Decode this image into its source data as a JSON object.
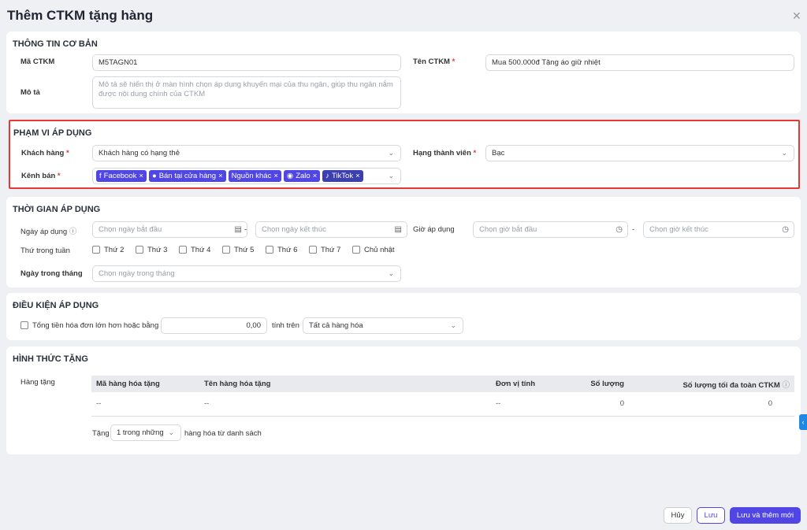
{
  "title": "Thêm CTKM tặng hàng",
  "basic": {
    "heading": "THÔNG TIN CƠ BẢN",
    "code_label": "Mã CTKM",
    "code_value": "M5TAGN01",
    "name_label": "Tên CTKM",
    "name_value": "Mua 500.000đ Tặng áo giữ nhiệt",
    "desc_label": "Mô tả",
    "desc_placeholder": "Mô tả sẽ hiển thị ở màn hình chọn áp dụng khuyến mại của thu ngân, giúp thu ngân nắm được nội dung chính của CTKM"
  },
  "scope": {
    "heading": "PHẠM VI ÁP DỤNG",
    "customer_label": "Khách hàng",
    "customer_value": "Khách hàng có hạng thẻ",
    "tier_label": "Hạng thành viên",
    "tier_value": "Bạc",
    "channel_label": "Kênh bán",
    "channels": [
      "Facebook",
      "Bán tại cửa hàng",
      "Nguồn khác",
      "Zalo",
      "TikTok"
    ],
    "required_mark": "*"
  },
  "time": {
    "heading": "THỜI GIAN ÁP DỤNG",
    "date_label": "Ngày áp dụng",
    "date_start_ph": "Chọn ngày bắt đầu",
    "date_end_ph": "Chọn ngày kết thúc",
    "hour_label": "Giờ áp dụng",
    "hour_start_ph": "Chọn giờ bắt đầu",
    "hour_end_ph": "Chọn giờ kết thúc",
    "dash": "-",
    "weekday_label": "Thứ trong tuần",
    "weekdays": [
      "Thứ 2",
      "Thứ 3",
      "Thứ 4",
      "Thứ 5",
      "Thứ 6",
      "Thứ 7",
      "Chủ nhật"
    ],
    "monthday_label": "Ngày trong tháng",
    "monthday_ph": "Chọn ngày trong tháng"
  },
  "cond": {
    "heading": "ĐIỀU KIỆN ÁP DỤNG",
    "total_label": "Tổng tiền hóa đơn lớn hơn hoặc bằng",
    "total_value": "0,00",
    "on_label": "tính trên",
    "on_value": "Tất cả hàng hóa"
  },
  "gift": {
    "heading": "HÌNH THỨC TẶNG",
    "items_label": "Hàng tặng",
    "columns": [
      "Mã hàng hóa tặng",
      "Tên hàng hóa tặng",
      "Đơn vị tính",
      "Số lượng",
      "Số lượng tối đa toàn CTKM"
    ],
    "row": [
      "--",
      "--",
      "--",
      "0",
      "0"
    ],
    "give_label": "Tặng",
    "give_value": "1 trong những",
    "give_suffix": "hàng hóa từ danh sách"
  },
  "buttons": {
    "cancel": "Hủy",
    "save": "Lưu",
    "save_new": "Lưu và thêm mới"
  },
  "colors": {
    "primary": "#4f46e5",
    "highlight": "#e53935"
  }
}
